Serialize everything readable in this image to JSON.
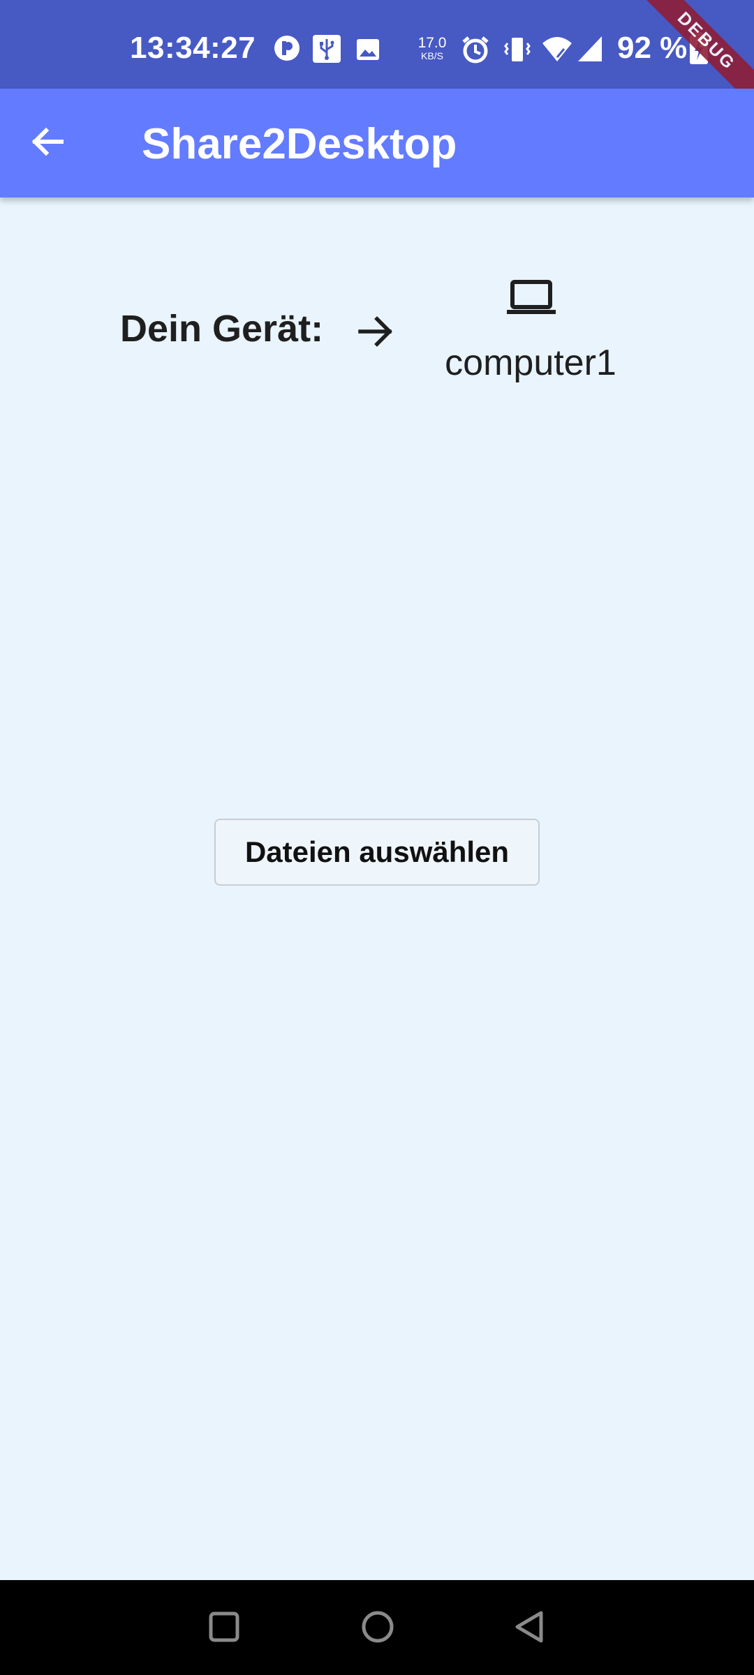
{
  "status_bar": {
    "time": "13:34:27",
    "net_speed_value": "17.0",
    "net_speed_unit": "KB/S",
    "battery": "92 %",
    "icons": [
      "app-notification-icon",
      "usb-icon",
      "image-icon",
      "alarm-icon",
      "vibrate-icon",
      "wifi-icon",
      "signal-icon",
      "battery-charging-icon"
    ]
  },
  "debug_banner": "DEBUG",
  "app_bar": {
    "title": "Share2Desktop",
    "back_icon": "arrow-back-icon"
  },
  "device": {
    "label": "Dein Gerät:",
    "arrow_icon": "arrow-forward-icon",
    "target_icon": "laptop-icon",
    "target_name": "computer1"
  },
  "actions": {
    "select_files_label": "Dateien auswählen"
  },
  "nav_bar": {
    "buttons": [
      "recents-square-icon",
      "home-circle-icon",
      "back-triangle-icon"
    ]
  },
  "colors": {
    "status_bar": "#4759C3",
    "app_bar": "#627BFF",
    "background": "#E9F4FD",
    "debug_ribbon": "#8E1F39"
  }
}
